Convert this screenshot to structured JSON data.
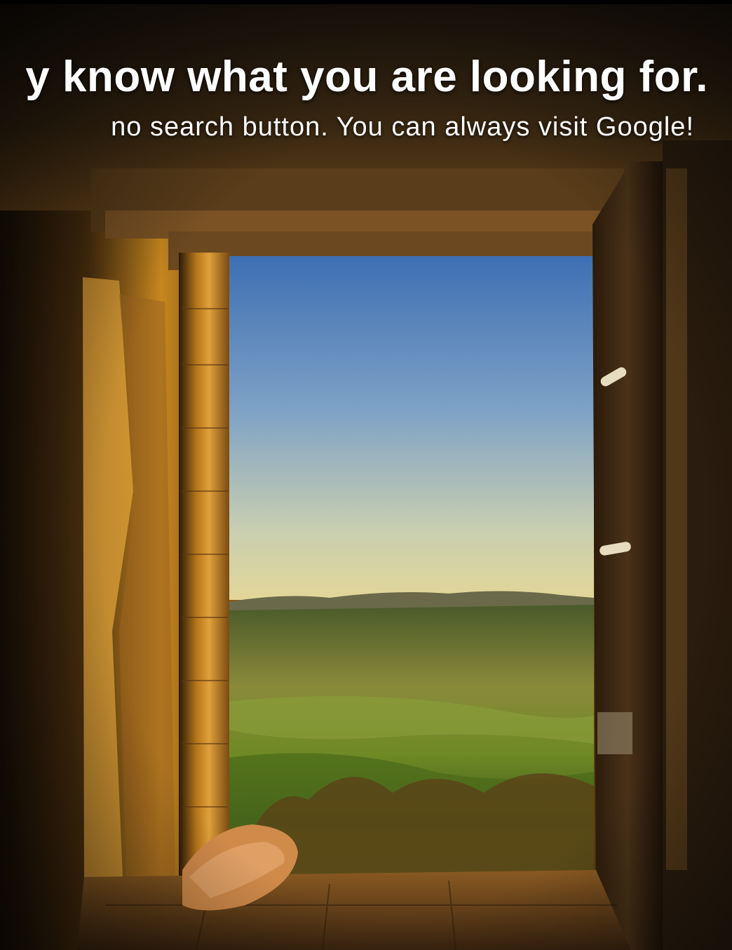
{
  "page": {
    "headline": "y know what you are looking for.",
    "subline": "no search button. You can always visit Google!",
    "background": {
      "description_icon": "window-landscape-photo",
      "text_color": "#ffffff",
      "sky_top": "#3e6fb3",
      "sky_horizon": "#dfd49a",
      "field_green": "#6e8a25",
      "wall_amber": "#c7871f",
      "wall_dark": "#2a1a0a"
    }
  }
}
